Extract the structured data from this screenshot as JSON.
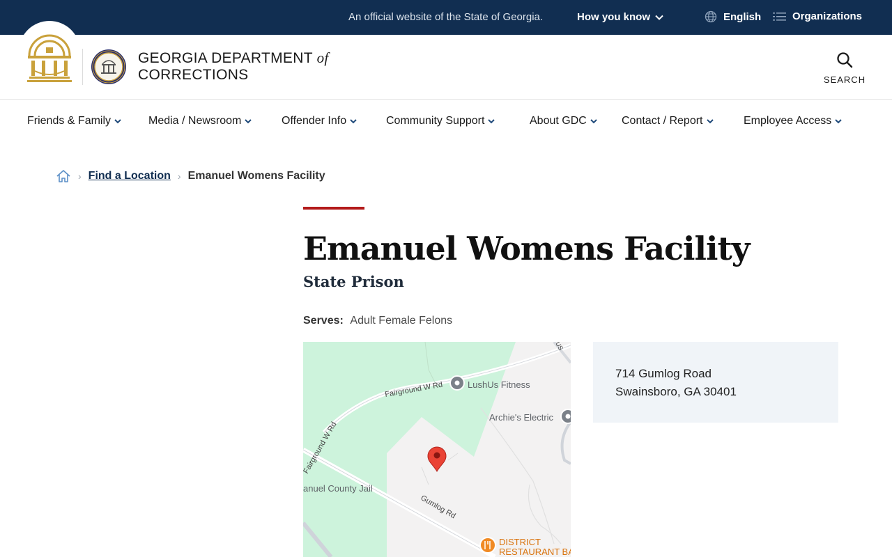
{
  "topbar": {
    "official_text": "An official website of the State of Georgia.",
    "how_you_know": "How you know",
    "language": "English",
    "organizations": "Organizations"
  },
  "header": {
    "brand_line1": "GEORGIA DEPARTMENT",
    "brand_of": "of",
    "brand_line2": "CORRECTIONS",
    "search_label": "SEARCH"
  },
  "nav": {
    "items": [
      {
        "label": "Friends & Family"
      },
      {
        "label": "Media / Newsroom"
      },
      {
        "label": "Offender Info"
      },
      {
        "label": "Community Support"
      },
      {
        "label": "About GDC"
      },
      {
        "label": "Contact / Report"
      },
      {
        "label": "Employee Access"
      }
    ]
  },
  "breadcrumb": {
    "link": "Find a Location",
    "current": "Emanuel Womens Facility"
  },
  "main": {
    "title": "Emanuel Womens Facility",
    "subtitle": "State Prison",
    "serves_label": "Serves:",
    "serves_value": "Adult Female Felons"
  },
  "map": {
    "labels": {
      "fairground_w_rd_top": "Fairground W Rd",
      "fairground_w_rd_left": "Fairground W Rd",
      "lushus": "LushUs Fitness",
      "archies": "Archie's Electric",
      "county_jail": "anuel County Jail",
      "gumlog_rd": "Gumlog Rd",
      "district_line1": "DISTRICT",
      "district_line2": "RESTAURANT BA",
      "road_top_right": "US"
    }
  },
  "address": {
    "line1": "714 Gumlog Road",
    "line2": "Swainsboro, GA 30401"
  },
  "colors": {
    "topbar": "#112e51",
    "accent_red": "#b31b1b",
    "gold": "#c9a13b",
    "address_bg": "#f0f4f8",
    "map_green": "#cdf3dc"
  }
}
